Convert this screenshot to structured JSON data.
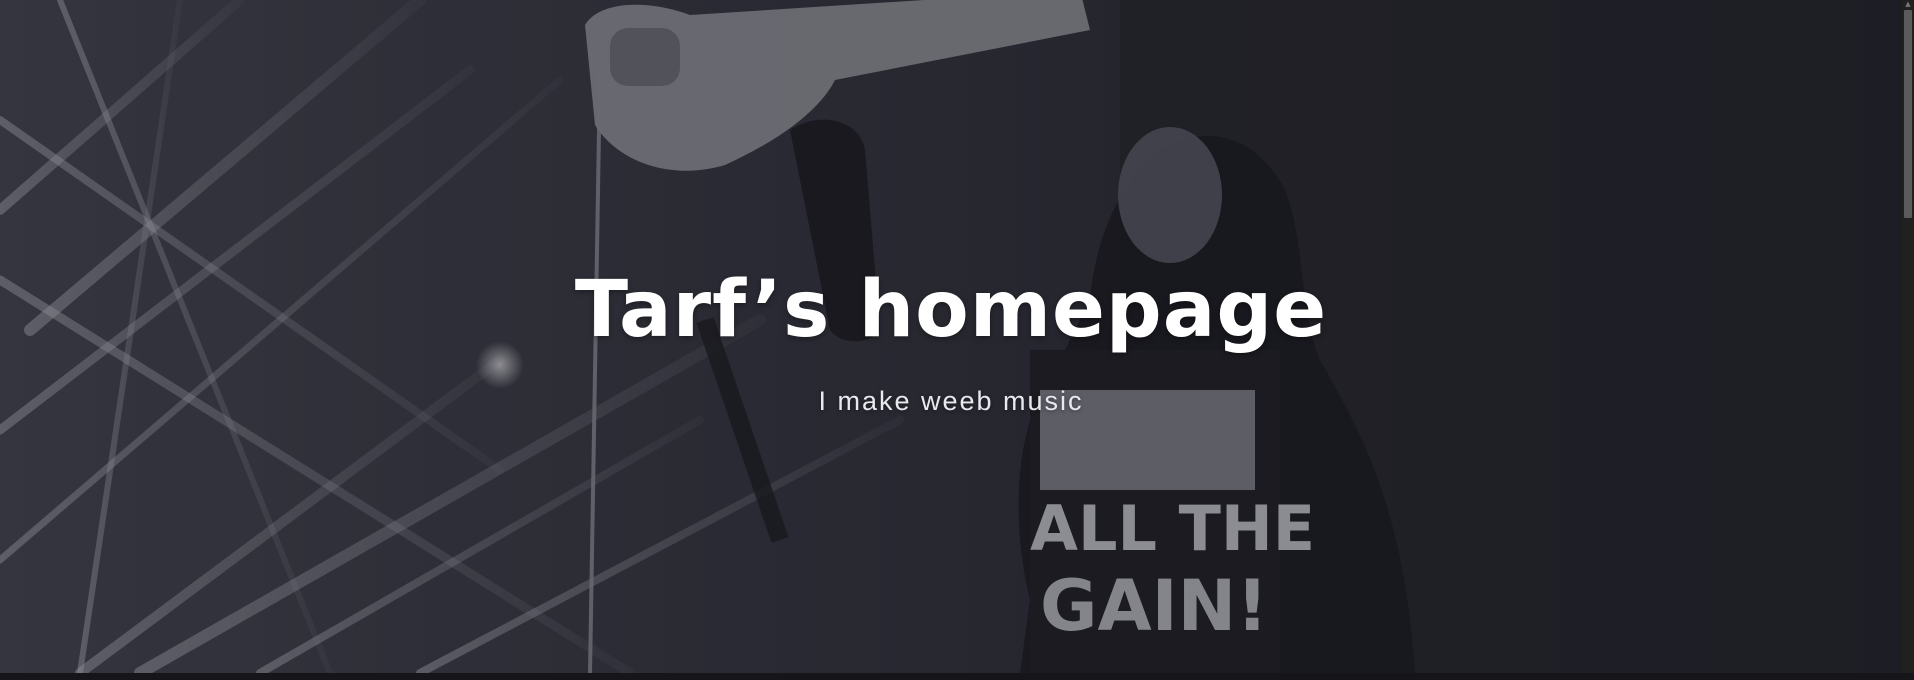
{
  "hero": {
    "title": "Tarf’s homepage",
    "tagline": "I make weeb music"
  },
  "colors": {
    "title": "#ffffff",
    "tagline": "#e8e8ee",
    "background": "#2a2a32"
  },
  "icons": {
    "scroll_up": "scroll-up-arrow-icon"
  }
}
